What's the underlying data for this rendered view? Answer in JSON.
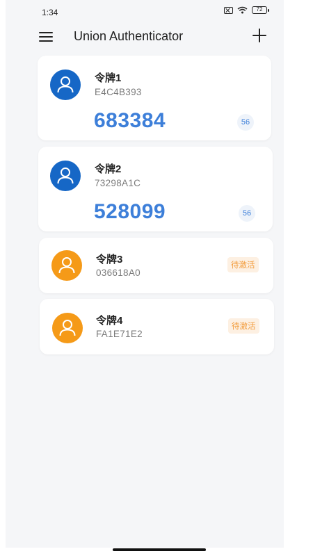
{
  "status_bar": {
    "time": "1:34",
    "battery": "72",
    "icons": [
      "sim-x-icon",
      "wifi-icon",
      "battery-icon"
    ]
  },
  "app_bar": {
    "title": "Union Authenticator",
    "menu_icon": "hamburger-menu-icon",
    "add_icon": "plus-icon"
  },
  "tokens": [
    {
      "name": "令牌1",
      "serial": "E4C4B393",
      "code": "683384",
      "seconds": "56",
      "status": "active",
      "avatar_color": "#1667c6"
    },
    {
      "name": "令牌2",
      "serial": "73298A1C",
      "code": "528099",
      "seconds": "56",
      "status": "active",
      "avatar_color": "#1667c6"
    },
    {
      "name": "令牌3",
      "serial": "036618A0",
      "badge": "待激活",
      "status": "inactive",
      "avatar_color": "#f59a18"
    },
    {
      "name": "令牌4",
      "serial": "FA1E71E2",
      "badge": "待激活",
      "status": "inactive",
      "avatar_color": "#f59a18"
    }
  ],
  "colors": {
    "accent_blue": "#3d7fd9",
    "avatar_blue": "#1667c6",
    "avatar_orange": "#f59a18",
    "badge_text": "#f29a38",
    "background": "#f5f6f8"
  }
}
